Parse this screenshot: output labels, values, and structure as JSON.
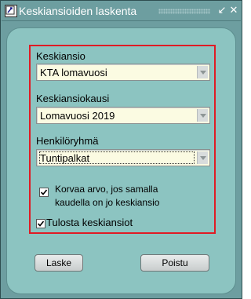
{
  "window": {
    "title": "Keskiansioiden laskenta",
    "minimize_glyph": "↙",
    "close_glyph": "✕"
  },
  "form": {
    "keskiansio": {
      "label": "Keskiansio",
      "value": "KTA lomavuosi"
    },
    "kausi": {
      "label": "Keskiansiokausi",
      "value": "Lomavuosi 2019"
    },
    "henkiloryhma": {
      "label": "Henkilöryhmä",
      "value": "Tuntipalkat"
    },
    "korvaa": {
      "line1": "Korvaa arvo, jos samalla",
      "line2": "kaudella on jo keskiansio",
      "checked": true
    },
    "tulosta": {
      "label": "Tulosta keskiansiot",
      "checked": true
    }
  },
  "buttons": {
    "laske": "Laske",
    "poistu": "Poistu"
  },
  "colors": {
    "window_bg": "#6d9ea0",
    "client_bg": "#8cc4c1",
    "field_bg": "#fbfbe2",
    "highlight_border": "#e01b24"
  }
}
